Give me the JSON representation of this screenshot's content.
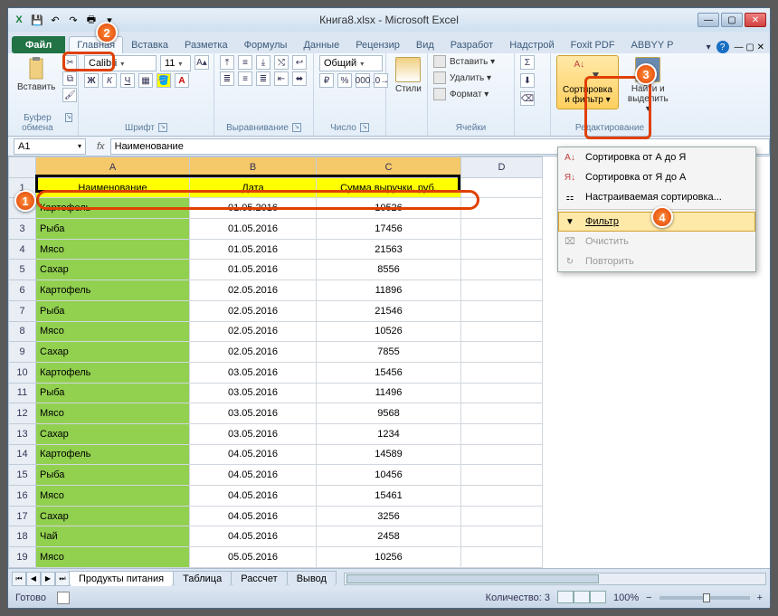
{
  "title": "Книга8.xlsx - Microsoft Excel",
  "qat": {
    "excel": "X",
    "save": "💾",
    "undo": "↶",
    "redo": "↷",
    "print": "🖶"
  },
  "tabs": {
    "file": "Файл",
    "items": [
      "Главная",
      "Вставка",
      "Разметка",
      "Формулы",
      "Данные",
      "Рецензир",
      "Вид",
      "Разработ",
      "Надстрой",
      "Foxit PDF",
      "ABBYY P"
    ]
  },
  "ribbon": {
    "clipboard": {
      "label": "Буфер обмена",
      "paste": "Вставить"
    },
    "font": {
      "label": "Шрифт",
      "name": "Calibri",
      "size": "11"
    },
    "align": {
      "label": "Выравнивание"
    },
    "number": {
      "label": "Число",
      "format": "Общий"
    },
    "styles": {
      "label": "Стили",
      "btn": "Стили"
    },
    "cells": {
      "label": "Ячейки",
      "insert": "Вставить ▾",
      "delete": "Удалить ▾",
      "format": "Формат ▾"
    },
    "editing": {
      "label": "Редактирование",
      "sort": "Сортировка и фильтр ▾",
      "find": "Найти и выделить ▾"
    }
  },
  "namebox": "A1",
  "formula": "Наименование",
  "cols": [
    "A",
    "B",
    "C",
    "D"
  ],
  "headers": [
    "Наименование",
    "Дата",
    "Сумма выручки, руб."
  ],
  "rows": [
    [
      "Картофель",
      "01.05.2016",
      "10526"
    ],
    [
      "Рыба",
      "01.05.2016",
      "17456"
    ],
    [
      "Мясо",
      "01.05.2016",
      "21563"
    ],
    [
      "Сахар",
      "01.05.2016",
      "8556"
    ],
    [
      "Картофель",
      "02.05.2016",
      "11896"
    ],
    [
      "Рыба",
      "02.05.2016",
      "21546"
    ],
    [
      "Мясо",
      "02.05.2016",
      "10526"
    ],
    [
      "Сахар",
      "02.05.2016",
      "7855"
    ],
    [
      "Картофель",
      "03.05.2016",
      "15456"
    ],
    [
      "Рыба",
      "03.05.2016",
      "11496"
    ],
    [
      "Мясо",
      "03.05.2016",
      "9568"
    ],
    [
      "Сахар",
      "03.05.2016",
      "1234"
    ],
    [
      "Картофель",
      "04.05.2016",
      "14589"
    ],
    [
      "Рыба",
      "04.05.2016",
      "10456"
    ],
    [
      "Мясо",
      "04.05.2016",
      "15461"
    ],
    [
      "Сахар",
      "04.05.2016",
      "3256"
    ],
    [
      "Чай",
      "04.05.2016",
      "2458"
    ],
    [
      "Мясо",
      "05.05.2016",
      "10256"
    ]
  ],
  "dropdown": {
    "sortAZ": "Сортировка от А до Я",
    "sortZA": "Сортировка от Я до А",
    "custom": "Настраиваемая сортировка...",
    "filter": "Фильтр",
    "clear": "Очистить",
    "reapply": "Повторить"
  },
  "sheets": [
    "Продукты питания",
    "Таблица",
    "Рассчет",
    "Вывод"
  ],
  "status": {
    "ready": "Готово",
    "count_label": "Количество:",
    "count": "3",
    "zoom": "100%"
  },
  "callouts": [
    "1",
    "2",
    "3",
    "4"
  ]
}
